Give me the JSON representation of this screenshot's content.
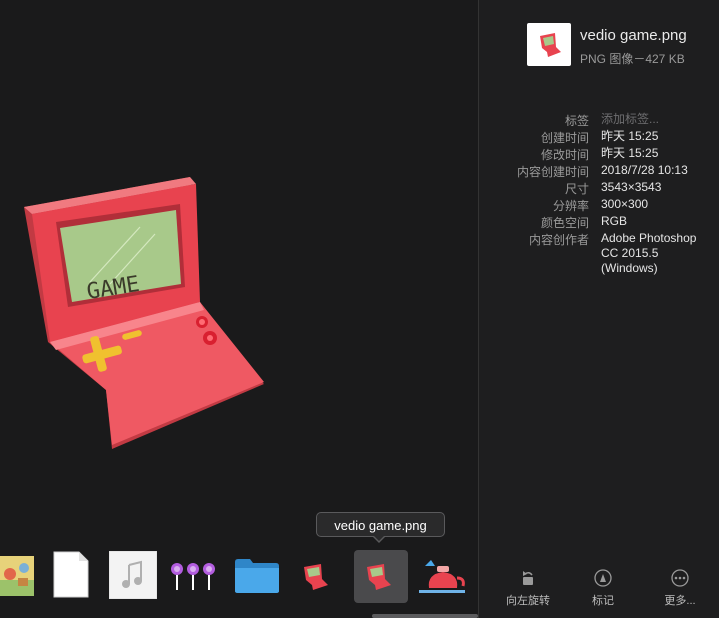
{
  "tooltip": "vedio game.png",
  "main_image": {
    "screen_text": "GAME"
  },
  "filmstrip": [
    {
      "name": "cartoon-scene-thumbnail-icon"
    },
    {
      "name": "blank-document-thumbnail-icon"
    },
    {
      "name": "music-file-thumbnail-icon"
    },
    {
      "name": "lollipop-thumbnail-icon"
    },
    {
      "name": "blue-folder-thumbnail-icon"
    },
    {
      "name": "video-game-thumbnail-icon"
    },
    {
      "name": "video-game-thumbnail-icon",
      "selected": true
    },
    {
      "name": "teapot-thumbnail-icon"
    }
  ],
  "info": {
    "file_name": "vedio game.png",
    "file_subtitle": "PNG 图像－427 KB",
    "metadata": [
      {
        "label": "标签",
        "value": "添加标签...",
        "placeholder": true
      },
      {
        "label": "创建时间",
        "value": "昨天 15:25"
      },
      {
        "label": "修改时间",
        "value": "昨天 15:25"
      },
      {
        "label": "内容创建时间",
        "value": "2018/7/28 10:13"
      },
      {
        "label": "尺寸",
        "value": "3543×3543"
      },
      {
        "label": "分辨率",
        "value": "300×300"
      },
      {
        "label": "颜色空间",
        "value": "RGB"
      },
      {
        "label": "内容创作者",
        "value": "Adobe Photoshop",
        "value2": "CC 2015.5",
        "value3": "(Windows)"
      }
    ]
  },
  "actions": {
    "rotate_left": "向左旋转",
    "markup": "标记",
    "more": "更多..."
  },
  "colors": {
    "background": "#1a1a1b",
    "game_body": "#e8434f",
    "game_screen": "#a8c98a",
    "folder_blue": "#3a9be0"
  }
}
